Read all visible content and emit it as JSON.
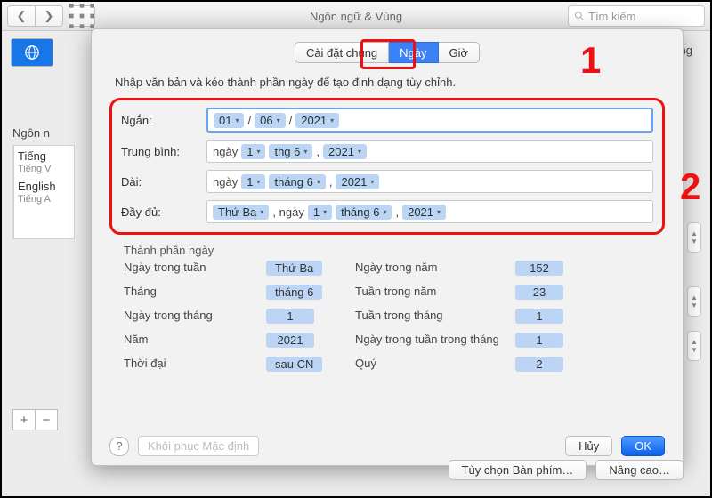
{
  "window": {
    "title": "Ngôn ngữ & Vùng",
    "search_placeholder": "Tìm kiếm",
    "right_label": "nh dạng"
  },
  "annotations": {
    "one": "1",
    "two": "2"
  },
  "sidebar": {
    "title": "Ngôn n",
    "items": [
      {
        "main": "Tiếng",
        "sub": "Tiếng V"
      },
      {
        "main": "English",
        "sub": "Tiếng A"
      }
    ]
  },
  "sheet": {
    "tabs": {
      "general": "Cài đặt chung",
      "date": "Ngày",
      "time": "Giờ"
    },
    "desc": "Nhập văn bản và kéo thành phần ngày để tạo định dạng tùy chỉnh.",
    "rows": {
      "short": {
        "label": "Ngắn:",
        "tokens": [
          "01",
          "06",
          "2021"
        ],
        "seps": [
          "/",
          "/"
        ]
      },
      "medium": {
        "label": "Trung bình:",
        "prefix": "ngày",
        "tokens": [
          "1",
          "thg 6",
          "2021"
        ],
        "seps": [
          "",
          ",",
          ""
        ]
      },
      "long": {
        "label": "Dài:",
        "prefix": "ngày",
        "tokens": [
          "1",
          "tháng 6",
          "2021"
        ],
        "seps": [
          "",
          ",",
          ""
        ]
      },
      "full": {
        "label": "Đầy đủ:",
        "tokens": [
          "Thứ Ba",
          "1",
          "tháng 6",
          "2021"
        ],
        "seps": [
          ", ngày",
          "",
          ",",
          ""
        ]
      }
    },
    "components": {
      "title": "Thành phần ngày",
      "left": [
        [
          "Ngày trong tuần",
          "Thứ Ba"
        ],
        [
          "Tháng",
          "tháng 6"
        ],
        [
          "Ngày trong tháng",
          "1"
        ],
        [
          "Năm",
          "2021"
        ],
        [
          "Thời đại",
          "sau CN"
        ]
      ],
      "right": [
        [
          "Ngày trong năm",
          "152"
        ],
        [
          "Tuần trong năm",
          "23"
        ],
        [
          "Tuần trong tháng",
          "1"
        ],
        [
          "Ngày trong tuần trong tháng",
          "1"
        ],
        [
          "Quý",
          "2"
        ]
      ]
    },
    "footer": {
      "restore": "Khôi phục Mặc định",
      "cancel": "Hủy",
      "ok": "OK"
    }
  },
  "bottom": {
    "keyboard": "Tùy chọn Bàn phím…",
    "advanced": "Nâng cao…"
  }
}
